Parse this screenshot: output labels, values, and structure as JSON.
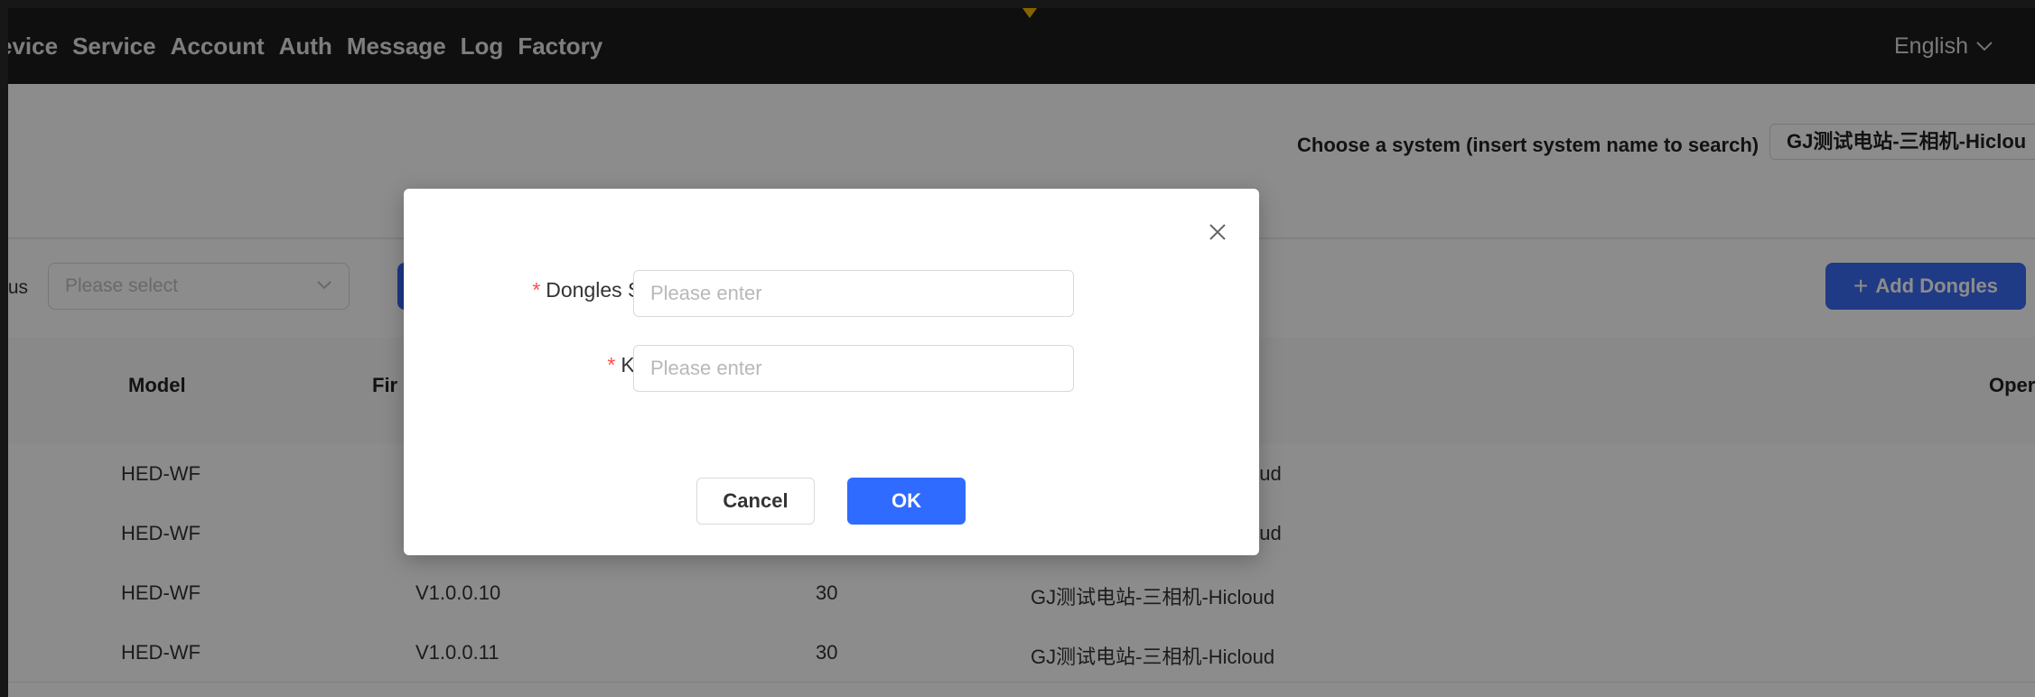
{
  "nav": {
    "items": [
      "evice",
      "Service",
      "Account",
      "Auth",
      "Message",
      "Log",
      "Factory"
    ],
    "language": "English"
  },
  "system": {
    "label": "Choose a system (insert system name to search)",
    "value": "GJ测试电站-三相机-Hiclou"
  },
  "filter": {
    "label": "tus",
    "placeholder": "Please select"
  },
  "toolbar": {
    "add_dongles_label": "Add Dongles"
  },
  "table": {
    "headers": {
      "model": "Model",
      "firmware": "Fir",
      "operation": "Oper"
    },
    "rows": [
      {
        "model": "HED-WF",
        "firmware": "",
        "value": "",
        "system": "oud"
      },
      {
        "model": "HED-WF",
        "firmware": "",
        "value": "",
        "system": "oud"
      },
      {
        "model": "HED-WF",
        "firmware": "V1.0.0.10",
        "value": "30",
        "system": "GJ测试电站-三相机-Hicloud"
      },
      {
        "model": "HED-WF",
        "firmware": "V1.0.0.11",
        "value": "30",
        "system": "GJ测试电站-三相机-Hicloud"
      }
    ]
  },
  "modal": {
    "fields": [
      {
        "label": "Dongles SN",
        "placeholder": "Please enter",
        "value": ""
      },
      {
        "label": "Key",
        "placeholder": "Please enter",
        "value": ""
      }
    ],
    "required_mark": "*",
    "cancel_label": "Cancel",
    "ok_label": "OK"
  },
  "colors": {
    "primary": "#2f6bff",
    "nav_bg": "#1c1c1c",
    "required": "#ff4d4f",
    "accent_marker": "#f5b800"
  }
}
